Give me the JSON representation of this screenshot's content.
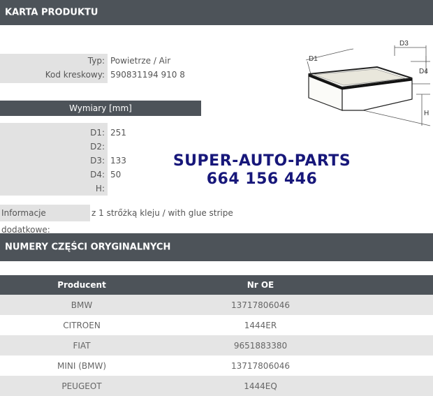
{
  "header": {
    "title": "KARTA PRODUKTU"
  },
  "product": {
    "type_label": "Typ:",
    "type_value": "Powietrze / Air",
    "barcode_label": "Kod kreskowy:",
    "barcode_value": "590831194 910 8"
  },
  "dimensions": {
    "header": "Wymiary [mm]",
    "rows": [
      {
        "label": "D1:",
        "value": "251"
      },
      {
        "label": "D2:",
        "value": ""
      },
      {
        "label": "D3:",
        "value": "133"
      },
      {
        "label": "D4:",
        "value": "50"
      },
      {
        "label": "H:",
        "value": ""
      }
    ]
  },
  "diagram": {
    "d1": "D1",
    "d3": "D3",
    "d4": "D4",
    "h": "H"
  },
  "watermark": {
    "line1": "SUPER-AUTO-PARTS",
    "line2": "664 156 446"
  },
  "extra_info": {
    "label": "Informacje dodatkowe:",
    "value": "z 1 strőżką kleju / with glue stripe"
  },
  "oe_section": {
    "title": "NUMERY CZĘŚCI ORYGINALNYCH",
    "columns": [
      "Producent",
      "Nr OE"
    ],
    "rows": [
      [
        "BMW",
        "13717806046"
      ],
      [
        "CITROEN",
        "1444ER"
      ],
      [
        "FIAT",
        "9651883380"
      ],
      [
        "MINI (BMW)",
        "13717806046"
      ],
      [
        "PEUGEOT",
        "1444EQ"
      ]
    ]
  }
}
